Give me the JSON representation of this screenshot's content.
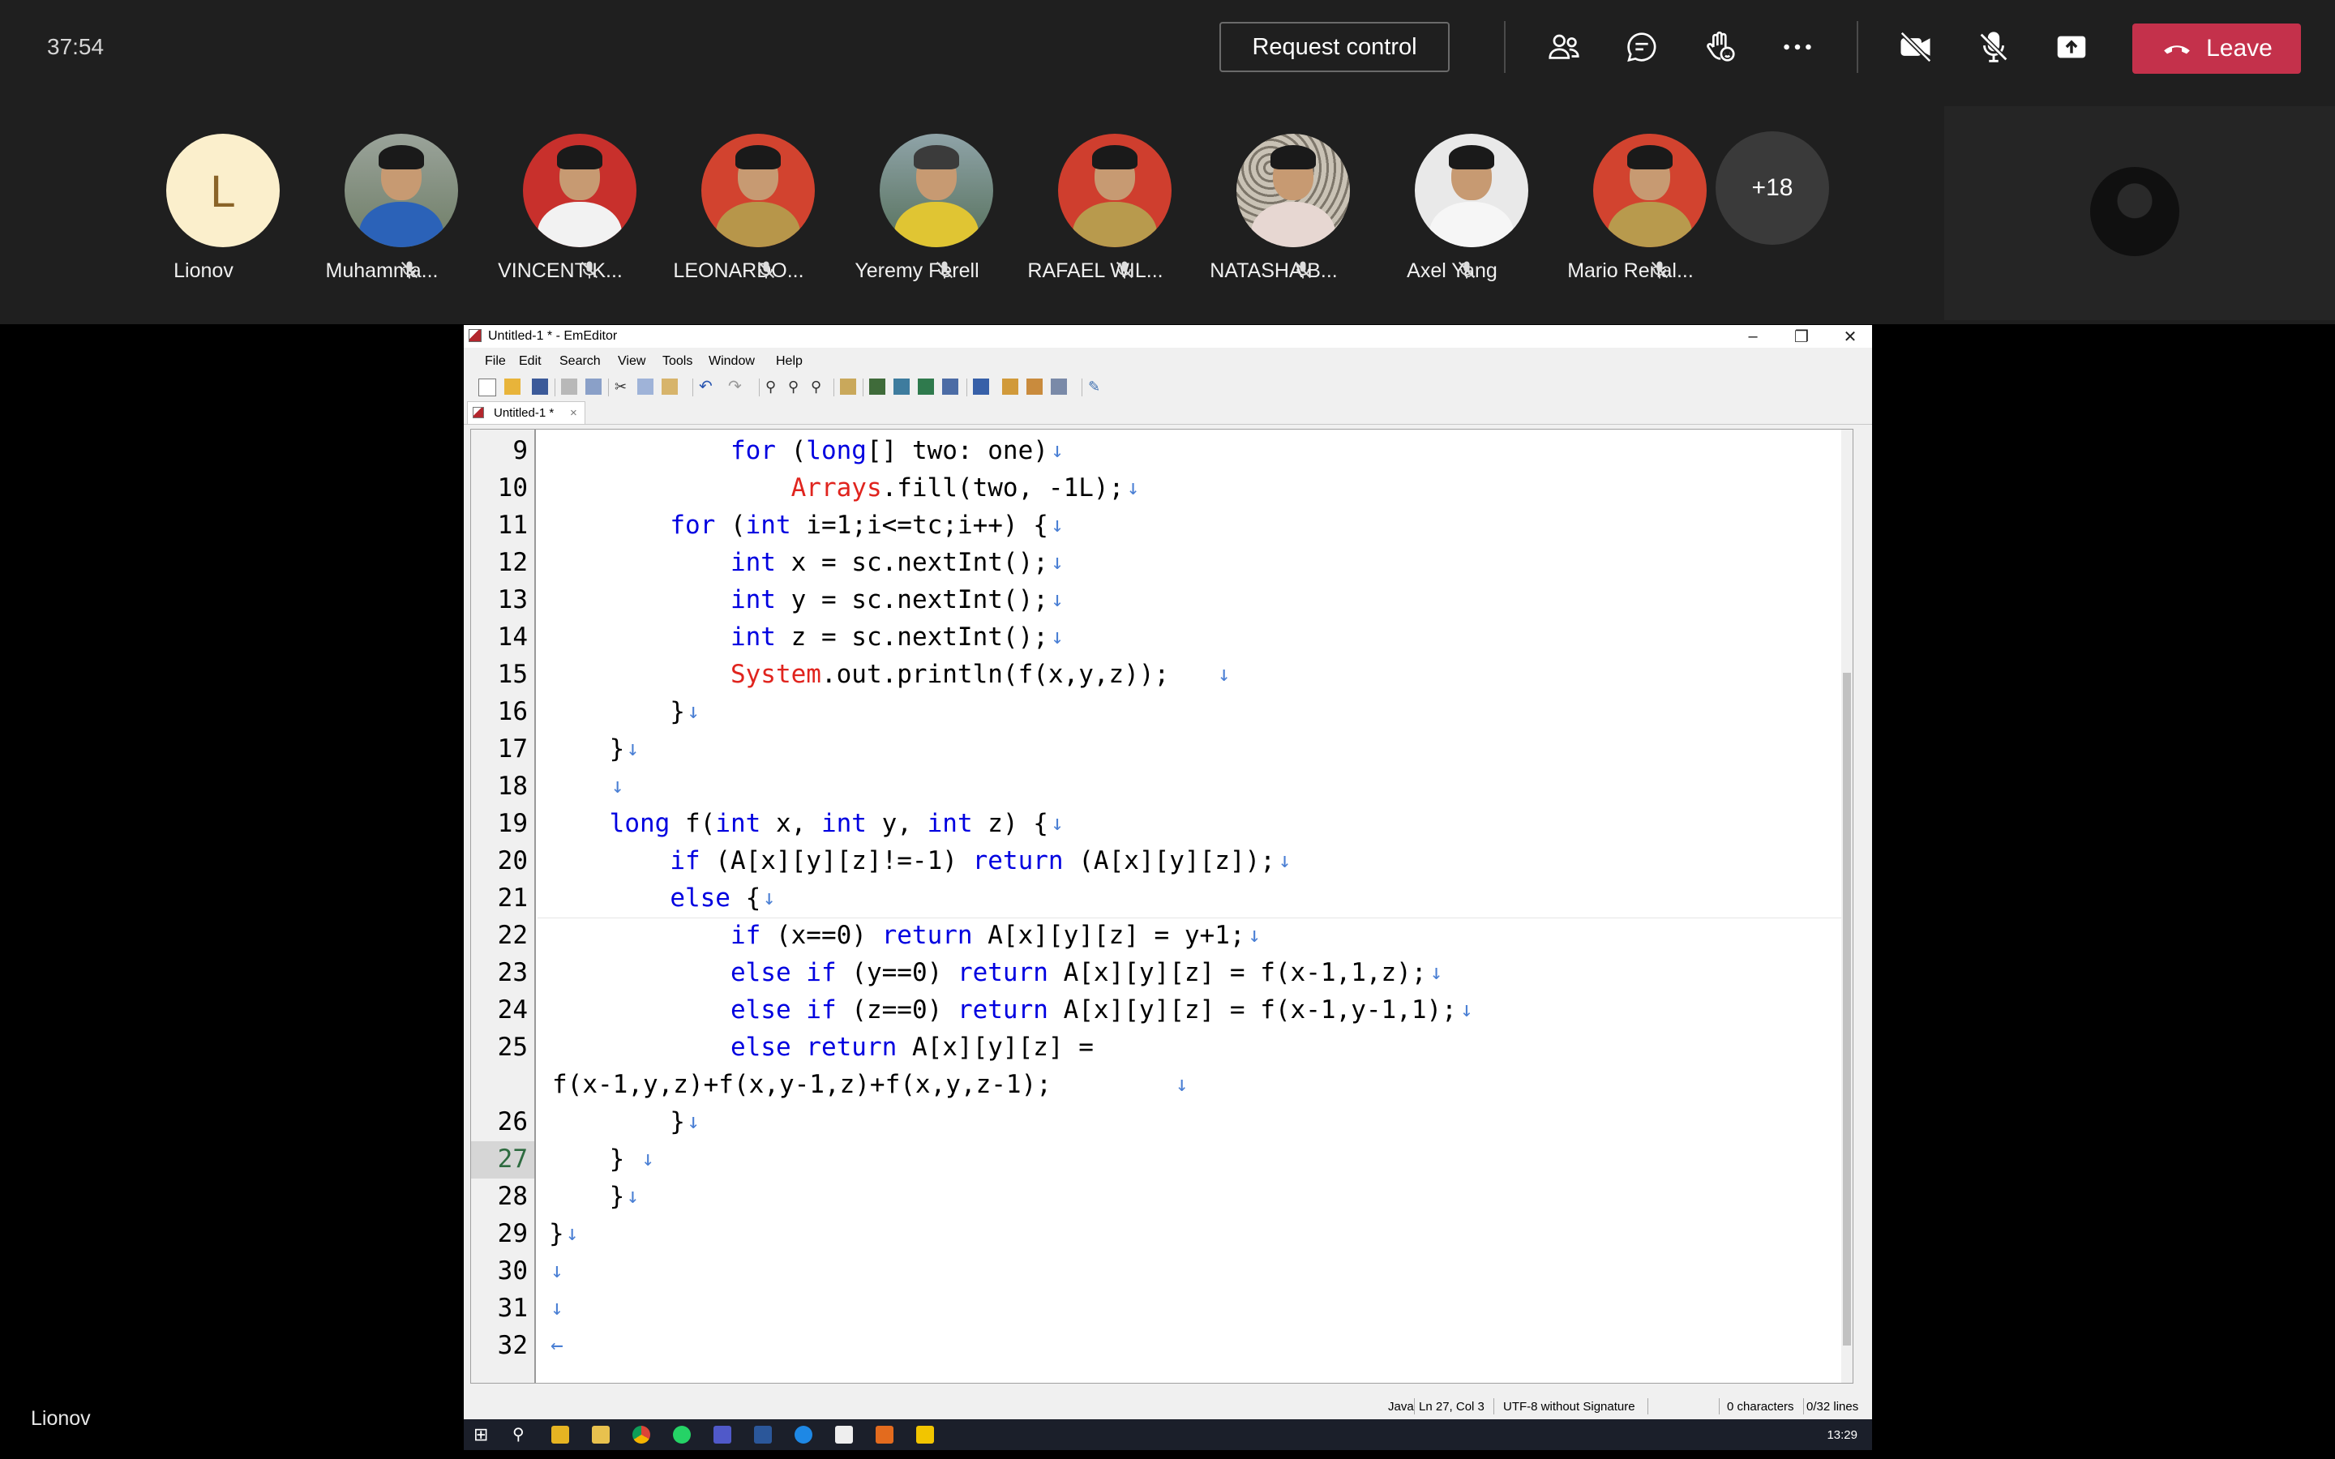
{
  "meeting": {
    "timer": "37:54",
    "request_control_label": "Request control",
    "leave_label": "Leave",
    "more_participants": "+18",
    "presenter_name": "Lionov",
    "participants": [
      {
        "name": "Lionov",
        "initial": "L",
        "muted": false
      },
      {
        "name": "Muhamma...",
        "muted": true
      },
      {
        "name": "VINCENT K...",
        "muted": true
      },
      {
        "name": "LEONARDO...",
        "muted": true
      },
      {
        "name": "Yeremy Ferell",
        "muted": true
      },
      {
        "name": "RAFAEL WIL...",
        "muted": true
      },
      {
        "name": "NATASHA B...",
        "muted": true
      },
      {
        "name": "Axel Yang",
        "muted": true
      },
      {
        "name": "Mario Renal...",
        "muted": true
      }
    ],
    "toolbar_icons": [
      "people-icon",
      "chat-icon",
      "raise-hand-icon",
      "more-icon",
      "camera-off-icon",
      "mic-off-icon",
      "share-tray-icon",
      "phone-hangup-icon"
    ]
  },
  "editor": {
    "window_title": "Untitled-1 * - EmEditor",
    "menu": [
      "File",
      "Edit",
      "Search",
      "View",
      "Tools",
      "Window",
      "Help"
    ],
    "tab_label": "Untitled-1 *",
    "current_line": "27",
    "lines": [
      {
        "num": "9",
        "text": "            for (long[] two: one)"
      },
      {
        "num": "10",
        "text": "                Arrays.fill(two, -1L);"
      },
      {
        "num": "11",
        "text": "        for (int i=1;i<=tc;i++) {"
      },
      {
        "num": "12",
        "text": "            int x = sc.nextInt();"
      },
      {
        "num": "13",
        "text": "            int y = sc.nextInt();"
      },
      {
        "num": "14",
        "text": "            int z = sc.nextInt();"
      },
      {
        "num": "15",
        "text": "            System.out.println(f(x,y,z));"
      },
      {
        "num": "16",
        "text": "        }"
      },
      {
        "num": "17",
        "text": "    }"
      },
      {
        "num": "18",
        "text": "    "
      },
      {
        "num": "19",
        "text": "    long f(int x, int y, int z) {"
      },
      {
        "num": "20",
        "text": "        if (A[x][y][z]!=-1) return (A[x][y][z]);"
      },
      {
        "num": "21",
        "text": "        else {"
      },
      {
        "num": "22",
        "text": "            if (x==0) return A[x][y][z] = y+1;"
      },
      {
        "num": "23",
        "text": "            else if (y==0) return A[x][y][z] = f(x-1,1,z);"
      },
      {
        "num": "24",
        "text": "            else if (z==0) return A[x][y][z] = f(x-1,y-1,1);"
      },
      {
        "num": "25",
        "text": "            else return A[x][y][z] ="
      },
      {
        "num": "",
        "text": "f(x-1,y,z)+f(x,y-1,z)+f(x,y,z-1);"
      },
      {
        "num": "26",
        "text": "        }"
      },
      {
        "num": "27",
        "text": "    }"
      },
      {
        "num": "28",
        "text": "    }"
      },
      {
        "num": "29",
        "text": "}"
      },
      {
        "num": "30",
        "text": ""
      },
      {
        "num": "31",
        "text": ""
      },
      {
        "num": "32",
        "text": ""
      }
    ],
    "status": {
      "language": "Java",
      "position": "Ln 27, Col 3",
      "encoding": "UTF-8 without Signature",
      "chars": "0 characters",
      "lines": "0/32 lines"
    }
  },
  "taskbar": {
    "time": "13:29"
  },
  "colors": {
    "leave": "#c4314b",
    "keyword": "#0000e0",
    "class_name": "#e0241e",
    "eol_mark": "#4a7fd4"
  }
}
